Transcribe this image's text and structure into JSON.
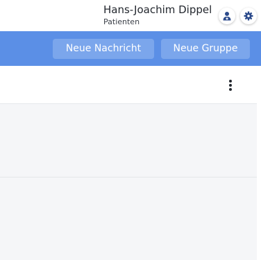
{
  "header": {
    "user_name": "Hans-Joachim Dippel",
    "user_role": "Patienten"
  },
  "actions": {
    "new_message": "Neue Nachricht",
    "new_group": "Neue Gruppe"
  },
  "icons": {
    "doctor": "doctor-icon",
    "settings": "gear-icon",
    "more": "more-vertical-icon"
  },
  "colors": {
    "accent": "#5b8fe6",
    "button": "#7ba6ec",
    "icon": "#2b4a8b"
  }
}
